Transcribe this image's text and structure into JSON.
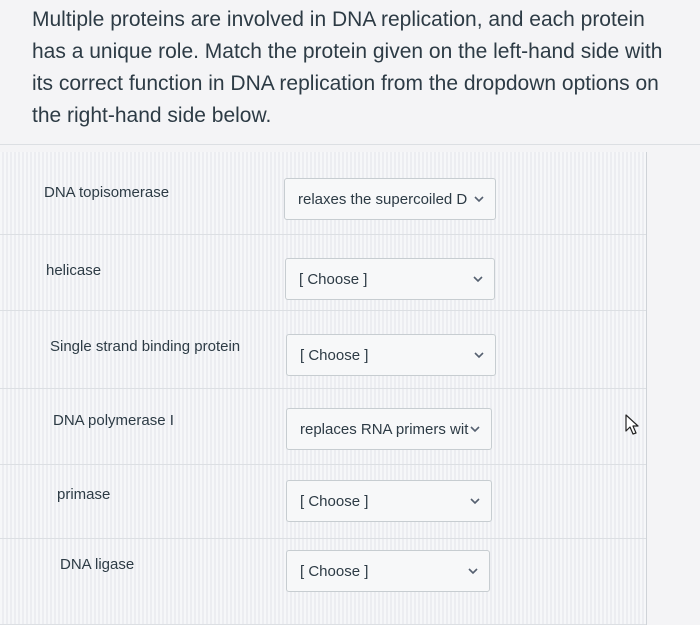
{
  "question": {
    "text": "Multiple proteins are involved in DNA replication, and each protein has a unique role. Match the protein given on the left-hand side with its correct function in DNA replication from the dropdown options on the right-hand side below."
  },
  "matches": [
    {
      "protein": "DNA topisomerase",
      "selected": "relaxes the supercoiled D"
    },
    {
      "protein": "helicase",
      "selected": "[ Choose ]"
    },
    {
      "protein": "Single strand binding protein",
      "selected": "[ Choose ]"
    },
    {
      "protein": "DNA polymerase I",
      "selected": "replaces RNA primers wit"
    },
    {
      "protein": "primase",
      "selected": "[ Choose ]"
    },
    {
      "protein": "DNA ligase",
      "selected": "[ Choose ]"
    }
  ],
  "icons": {
    "dropdown": "chevron-down-icon",
    "pointer": "mouse-cursor-icon"
  },
  "colors": {
    "text": "#2d3b45",
    "background": "#f4f4f6",
    "select_border": "#c7cdd1"
  }
}
